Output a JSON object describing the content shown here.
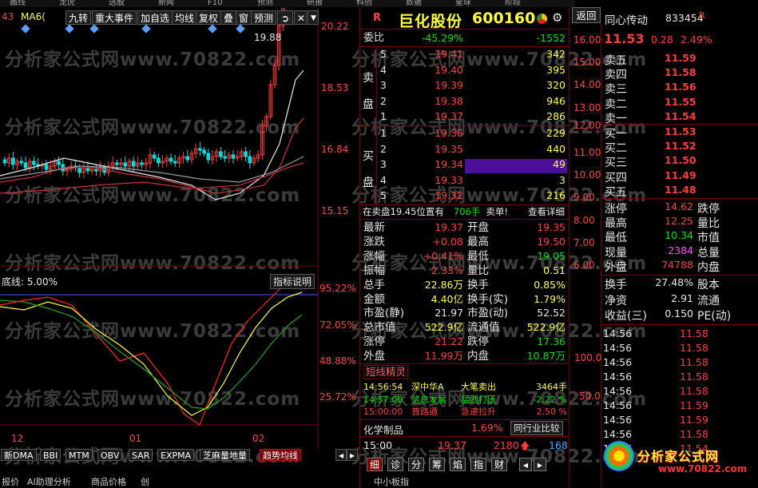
{
  "top_strip": [
    "画线",
    "龙虎",
    "选股",
    "新闻",
    "F10",
    "预测",
    "研报",
    "科创",
    "数据",
    "星球",
    "阶段"
  ],
  "chart": {
    "symbol_code": "43",
    "ma_label": "MA6(",
    "toolbar": [
      "九转",
      "重大事件",
      "加自选",
      "均线",
      "复权",
      "叠",
      "窗",
      "预测"
    ],
    "price_ticks": [
      "20.22",
      "18.53",
      "16.84",
      "15.15"
    ],
    "high_label": "19.88",
    "ind_label": "底线: 5.00%",
    "ind_button": "指标说明",
    "ind_ticks": [
      "95.22%",
      "72.05%",
      "48.88%",
      "25.72%"
    ],
    "date_ticks": [
      "12",
      "01",
      "02"
    ],
    "tabs": [
      "新DMA",
      "BBI",
      "MTM",
      "OBV",
      "SAR",
      "EXPMA",
      "芝麻量地量",
      "趋势均线"
    ],
    "active_tab": "趋势均线",
    "bottom_tabs": [
      "报价",
      "AI助理分析",
      "商品价格",
      "创",
      "中小板指"
    ]
  },
  "quote": {
    "badge": "R",
    "name": "巨化股份",
    "code": "600160",
    "weibi_label": "委比",
    "weibi_pct": "-45.29%",
    "weibi_val": "-1552",
    "sell_label": [
      "卖",
      "盘"
    ],
    "buy_label": [
      "买",
      "盘"
    ],
    "sell": [
      {
        "n": "5",
        "p": "19.41",
        "v": "342"
      },
      {
        "n": "4",
        "p": "19.40",
        "v": "395"
      },
      {
        "n": "3",
        "p": "19.39",
        "v": "320"
      },
      {
        "n": "2",
        "p": "19.38",
        "v": "946"
      },
      {
        "n": "1",
        "p": "19.37",
        "v": "286"
      }
    ],
    "buy": [
      {
        "n": "1",
        "p": "19.36",
        "v": "229"
      },
      {
        "n": "2",
        "p": "19.35",
        "v": "440"
      },
      {
        "n": "3",
        "p": "19.34",
        "v": "49"
      },
      {
        "n": "4",
        "p": "19.33",
        "v": "3"
      },
      {
        "n": "5",
        "p": "19.32",
        "v": "216"
      }
    ],
    "msg_a": "在卖盘19.45位置有",
    "msg_b": "706手",
    "msg_c": "卖单!",
    "msg_d": "查看详细",
    "stats": [
      {
        "l": "最新",
        "v": "19.37",
        "l2": "开盘",
        "v2": "19.35"
      },
      {
        "l": "涨跌",
        "v": "+0.08",
        "l2": "最高",
        "v2": "19.50"
      },
      {
        "l": "涨幅",
        "v": "+0.41%",
        "l2": "最低",
        "v2": "19.05"
      },
      {
        "l": "振幅",
        "v": "2.33%",
        "l2": "量比",
        "v2": "0.51"
      },
      {
        "l": "总手",
        "v": "22.86万",
        "l2": "换手",
        "v2": "0.85%"
      },
      {
        "l": "金额",
        "v": "4.40亿",
        "l2": "换手(实)",
        "v2": "1.79%"
      },
      {
        "l": "市盈(静)",
        "v": "21.97",
        "l2": "市盈(动)",
        "v2": "52.52"
      },
      {
        "l": "总市值",
        "v": "522.9亿",
        "l2": "流通值",
        "v2": "522.9亿"
      },
      {
        "l": "涨停",
        "v": "21.22",
        "l2": "跌停",
        "v2": "17.36"
      },
      {
        "l": "外盘",
        "v": "11.99万",
        "l2": "内盘",
        "v2": "10.87万"
      }
    ],
    "sprite_title": "短线精灵",
    "sprites": [
      {
        "t": "14:56:54",
        "n": "深中华A",
        "e": "大笔卖出",
        "v": "3464手"
      },
      {
        "t": "14:57:00",
        "n": "信息发展",
        "e": "猛烈打压",
        "v": "-2.22 %"
      },
      {
        "t": "15:00:00",
        "n": "普路通",
        "e": "急速拉升",
        "v": "2.50 %"
      }
    ],
    "industry": "化学制品",
    "industry_pct": "1.69%",
    "industry_btn": "同行业比较",
    "last_time": "15:00",
    "last_price": "19.37",
    "last_vol": "2180",
    "last_n": "168",
    "footer_tabs": [
      "细",
      "诊",
      "分",
      "筹",
      "焰",
      "指",
      "财"
    ]
  },
  "side": {
    "back": "返回",
    "name": "同心传动",
    "code": "833454",
    "badge": "R",
    "price": "11.53",
    "chg": "0.28",
    "pct": "2.49%",
    "axis": [
      "16.00",
      "15.00",
      "14.00",
      "13.00",
      "12.00",
      "11.00",
      "10.00",
      "9.00",
      "8.00",
      "7.00",
      "6.00"
    ],
    "vol_axis": [
      "100.0",
      "50.0"
    ],
    "asks": [
      {
        "l": "卖五",
        "v": "11.59"
      },
      {
        "l": "卖四",
        "v": "11.58"
      },
      {
        "l": "卖三",
        "v": "11.56"
      },
      {
        "l": "卖二",
        "v": "11.55"
      },
      {
        "l": "卖一",
        "v": "11.54"
      }
    ],
    "bids": [
      {
        "l": "买一",
        "v": "11.53"
      },
      {
        "l": "买二",
        "v": "11.52"
      },
      {
        "l": "买三",
        "v": "11.50"
      },
      {
        "l": "买四",
        "v": "11.49"
      },
      {
        "l": "买五",
        "v": "11.48"
      }
    ],
    "info": [
      {
        "l": "涨停",
        "v": "14.62",
        "r": "跌停"
      },
      {
        "l": "最高",
        "v": "12.25",
        "r": "量比"
      },
      {
        "l": "最低",
        "v": "10.34",
        "r": "市值"
      },
      {
        "l": "现量",
        "v": "2384",
        "r": "总量"
      },
      {
        "l": "外盘",
        "v": "74788",
        "r": "内盘"
      }
    ],
    "info2": [
      {
        "l": "换手",
        "v": "27.48%",
        "r": "股本"
      },
      {
        "l": "净资",
        "v": "2.91",
        "r": "流通"
      },
      {
        "l": "收益(三)",
        "v": "0.150",
        "r": "PE(动)"
      }
    ],
    "ticks": [
      {
        "t": "14:56",
        "p": "11.58"
      },
      {
        "t": "14:56",
        "p": "11.58"
      },
      {
        "t": "14:56",
        "p": "11.58"
      },
      {
        "t": "14:56",
        "p": "11.58"
      },
      {
        "t": "14:56",
        "p": "11.58"
      },
      {
        "t": "14:56",
        "p": "11.59"
      },
      {
        "t": "14:56",
        "p": "11.59"
      },
      {
        "t": "14:56",
        "p": "11.58"
      },
      {
        "t": "14:56",
        "p": "11.54"
      }
    ],
    "logo": "分析家公式网",
    "logo_url": "www.70822.com"
  },
  "watermark": "分析家公式网www.70822.com",
  "colors": {
    "up": "#ff3b3b",
    "down": "#00e000",
    "grid": "#7a0000",
    "ma1": "#e8e8e8",
    "ma2": "#ffff00",
    "ma3": "#c83232",
    "ind_red": "#ff2020",
    "ind_yellow": "#ffff30",
    "ind_green": "#20a020"
  }
}
